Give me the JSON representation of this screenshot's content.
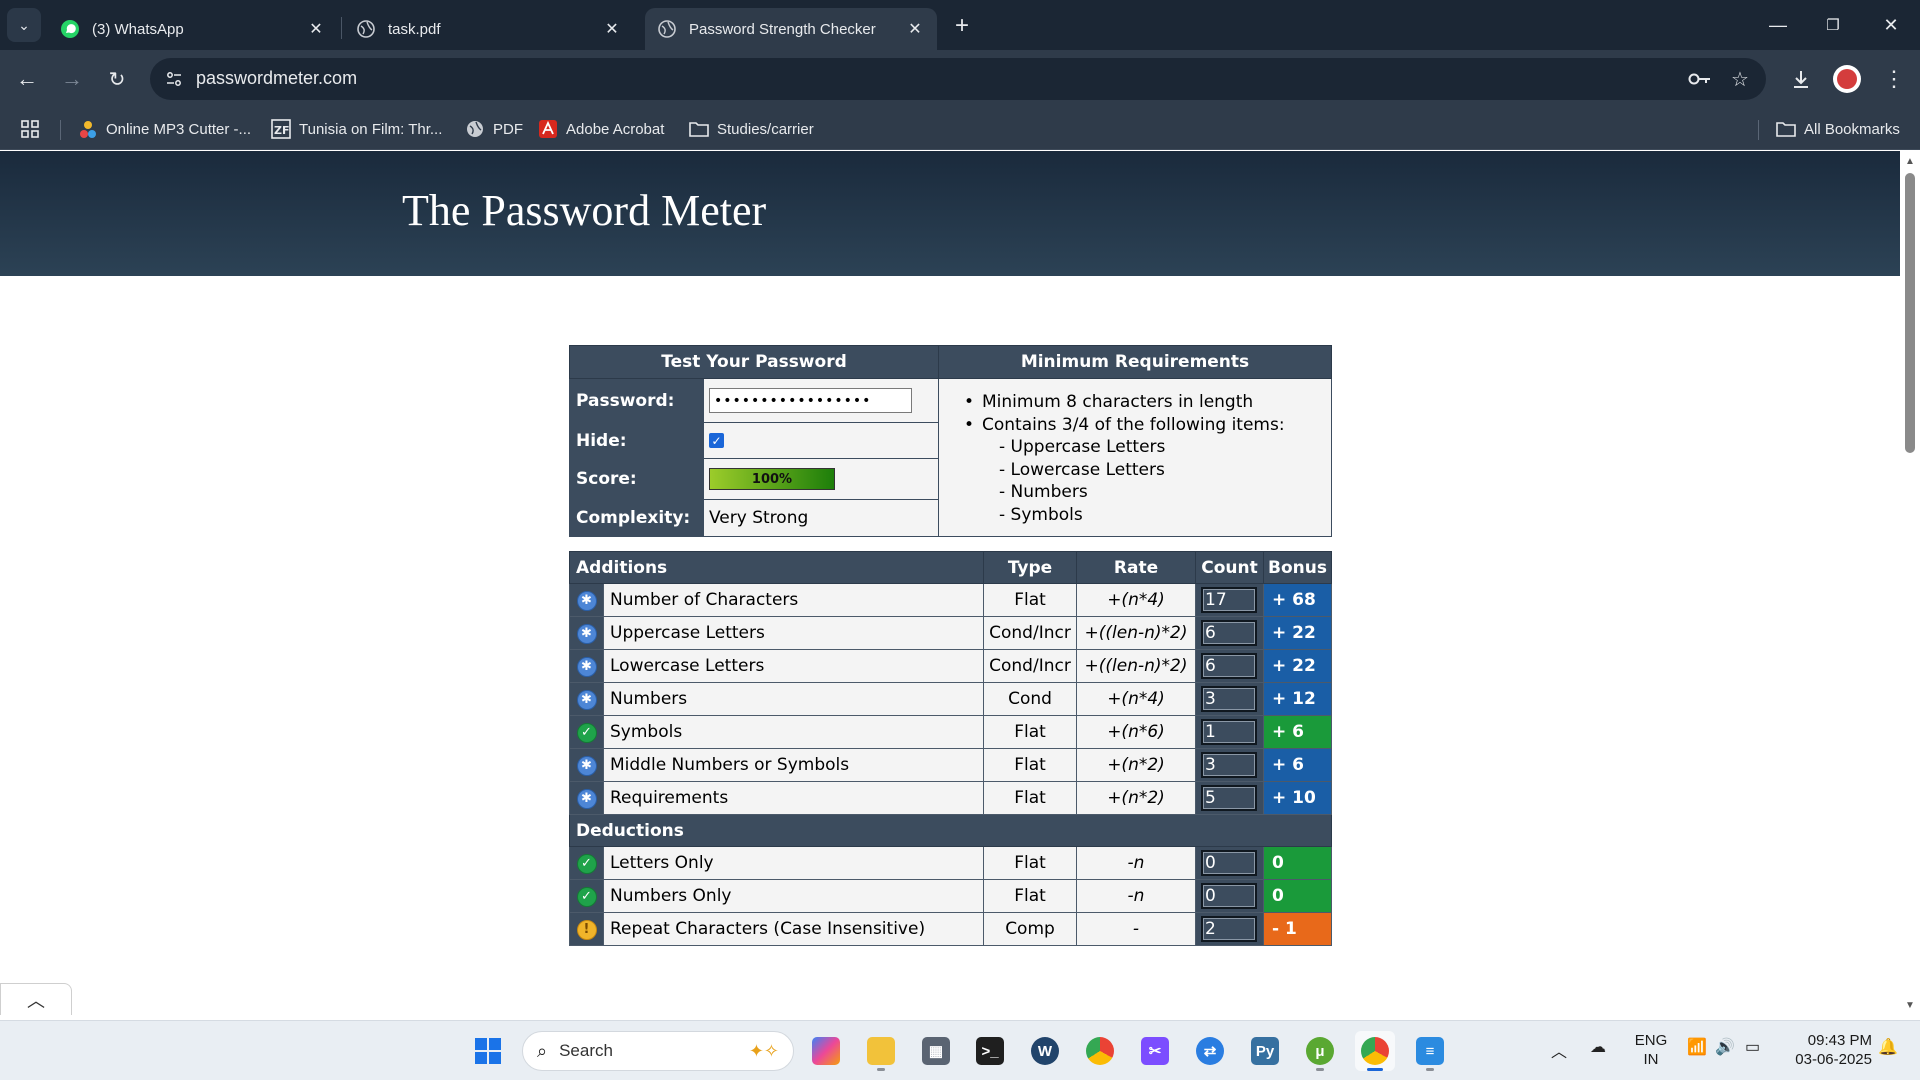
{
  "browser": {
    "tabs": [
      {
        "title": "(3) WhatsApp",
        "icon": "whatsapp-icon",
        "active": false
      },
      {
        "title": "task.pdf",
        "icon": "globe-icon",
        "active": false
      },
      {
        "title": "Password Strength Checker",
        "icon": "globe-icon",
        "active": true
      }
    ],
    "url": "passwordmeter.com",
    "bookmarks": [
      {
        "label": "Online MP3 Cutter -...",
        "icon": "mp3-cutter-icon"
      },
      {
        "label": "Tunisia on Film: Thr...",
        "icon": "zf-icon"
      },
      {
        "label": "PDF",
        "icon": "globe-icon"
      },
      {
        "label": "Adobe Acrobat",
        "icon": "acrobat-icon"
      },
      {
        "label": "Studies/carrier",
        "icon": "folder-icon"
      }
    ],
    "all_bookmarks": "All Bookmarks"
  },
  "page": {
    "title": "The Password Meter",
    "test": {
      "header": "Test Your Password",
      "password_label": "Password:",
      "password_value": "•••••••••••••••••",
      "hide_label": "Hide:",
      "hide_checked": true,
      "score_label": "Score:",
      "score_value": "100%",
      "score_fraction": 1.0,
      "complexity_label": "Complexity:",
      "complexity_value": "Very Strong"
    },
    "requirements": {
      "header": "Minimum Requirements",
      "items": [
        "Minimum 8 characters in length",
        "Contains 3/4 of the following items:"
      ],
      "sub_items": [
        "- Uppercase Letters",
        "- Lowercase Letters",
        "- Numbers",
        "- Symbols"
      ]
    },
    "columns": {
      "additions": "Additions",
      "type": "Type",
      "rate": "Rate",
      "count": "Count",
      "bonus": "Bonus",
      "deductions": "Deductions"
    },
    "additions": [
      {
        "name": "Number of Characters",
        "type": "Flat",
        "rate": "+(n*4)",
        "count": "17",
        "bonus": "+ 68",
        "status": "info",
        "bonus_color": "blue"
      },
      {
        "name": "Uppercase Letters",
        "type": "Cond/Incr",
        "rate": "+((len-n)*2)",
        "count": "6",
        "bonus": "+ 22",
        "status": "info",
        "bonus_color": "blue"
      },
      {
        "name": "Lowercase Letters",
        "type": "Cond/Incr",
        "rate": "+((len-n)*2)",
        "count": "6",
        "bonus": "+ 22",
        "status": "info",
        "bonus_color": "blue"
      },
      {
        "name": "Numbers",
        "type": "Cond",
        "rate": "+(n*4)",
        "count": "3",
        "bonus": "+ 12",
        "status": "info",
        "bonus_color": "blue"
      },
      {
        "name": "Symbols",
        "type": "Flat",
        "rate": "+(n*6)",
        "count": "1",
        "bonus": "+ 6",
        "status": "ok",
        "bonus_color": "green"
      },
      {
        "name": "Middle Numbers or Symbols",
        "type": "Flat",
        "rate": "+(n*2)",
        "count": "3",
        "bonus": "+ 6",
        "status": "info",
        "bonus_color": "blue"
      },
      {
        "name": "Requirements",
        "type": "Flat",
        "rate": "+(n*2)",
        "count": "5",
        "bonus": "+ 10",
        "status": "info",
        "bonus_color": "blue"
      }
    ],
    "deductions": [
      {
        "name": "Letters Only",
        "type": "Flat",
        "rate": "-n",
        "count": "0",
        "bonus": "0",
        "status": "ok",
        "bonus_color": "green"
      },
      {
        "name": "Numbers Only",
        "type": "Flat",
        "rate": "-n",
        "count": "0",
        "bonus": "0",
        "status": "ok",
        "bonus_color": "green"
      },
      {
        "name": "Repeat Characters (Case Insensitive)",
        "type": "Comp",
        "rate": "-",
        "count": "2",
        "bonus": "- 1",
        "status": "warn",
        "bonus_color": "orange"
      }
    ]
  },
  "taskbar": {
    "search_placeholder": "Search",
    "lang_line1": "ENG",
    "lang_line2": "IN",
    "time": "09:43 PM",
    "date": "03-06-2025"
  },
  "colors": {
    "header_bg": "#3c4c5e",
    "bonus_blue": "#1a5ea6",
    "bonus_green": "#1a9a3a",
    "bonus_orange": "#e8691a",
    "browser_dark": "#1b2634"
  }
}
